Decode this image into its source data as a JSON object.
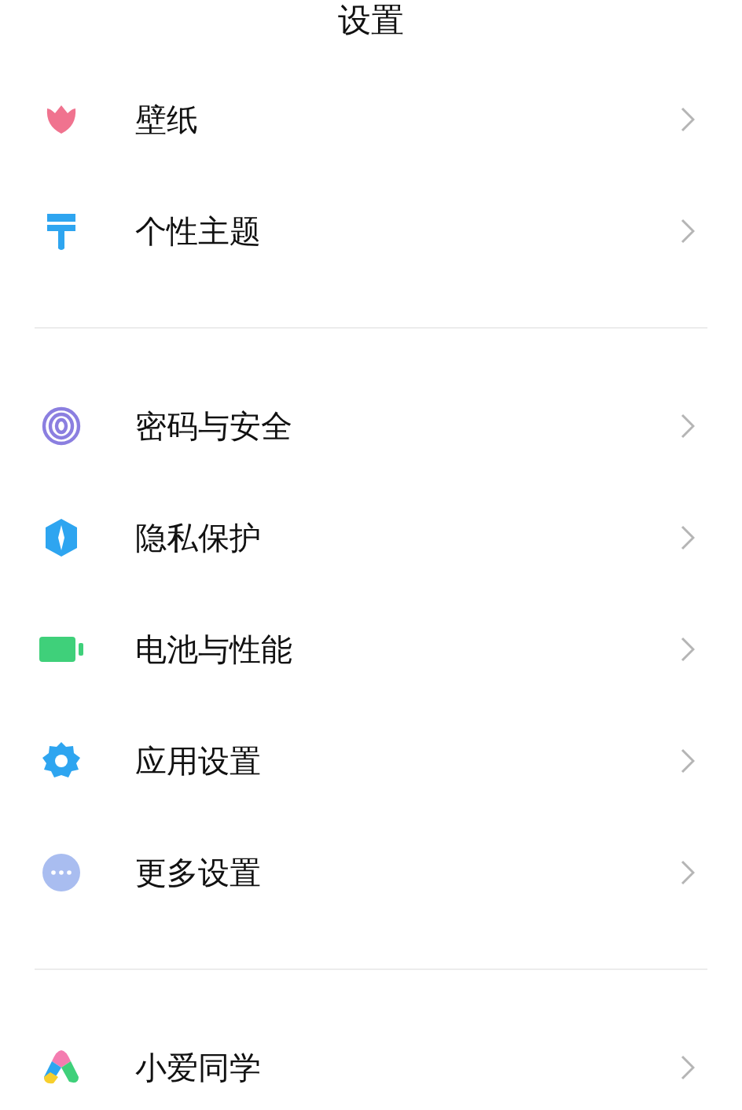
{
  "title": "设置",
  "groups": [
    {
      "items": [
        {
          "label": "壁纸",
          "kind": "flower"
        },
        {
          "label": "个性主题",
          "kind": "brush"
        }
      ]
    },
    {
      "items": [
        {
          "label": "密码与安全",
          "kind": "fingerprint"
        },
        {
          "label": "隐私保护",
          "kind": "shield"
        },
        {
          "label": "电池与性能",
          "kind": "battery"
        },
        {
          "label": "应用设置",
          "kind": "gear"
        },
        {
          "label": "更多设置",
          "kind": "more"
        }
      ]
    },
    {
      "items": [
        {
          "label": "小爱同学",
          "kind": "assistant"
        }
      ]
    }
  ]
}
